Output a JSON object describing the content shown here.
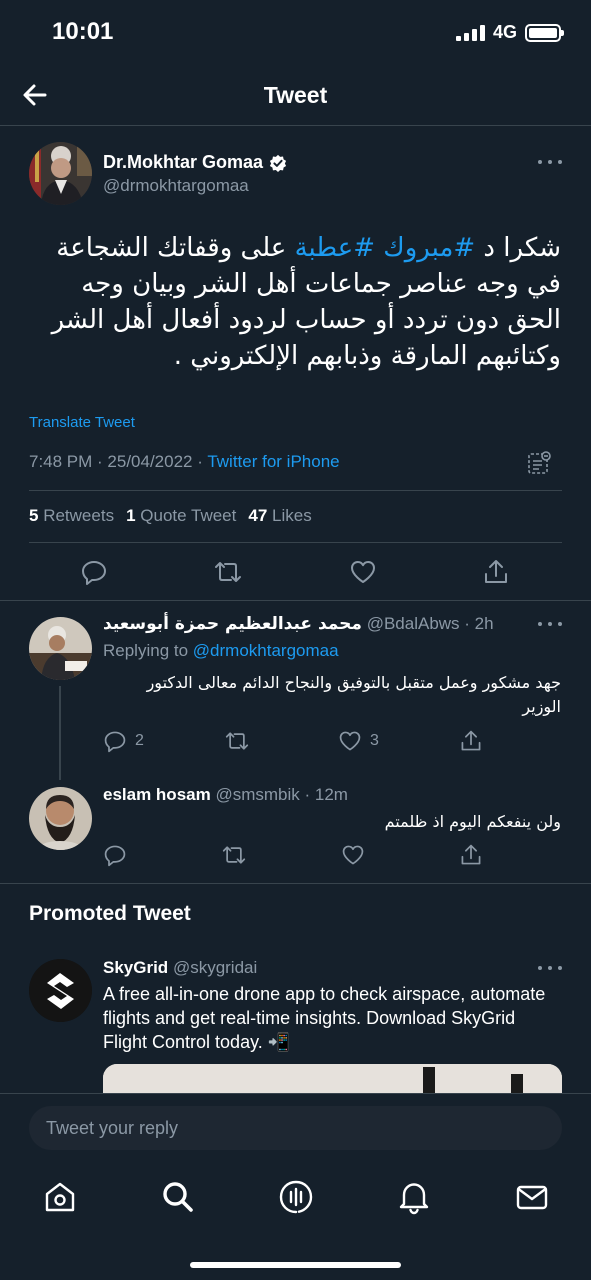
{
  "status_bar": {
    "time": "10:01",
    "network": "4G"
  },
  "header": {
    "title": "Tweet"
  },
  "tweet": {
    "author_name": "Dr.Mokhtar Gomaa",
    "author_handle": "@drmokhtargomaa",
    "verified": true,
    "text_before": "شكرا د ",
    "hashtag1": "#مبروك",
    "space": " ",
    "hashtag2": "#عطبة",
    "text_after": " على وقفاتك الشجاعة في وجه عناصر جماعات أهل الشر وبيان وجه الحق دون تردد أو حساب لردود أفعال أهل الشر وكتائبهم المارقة وذبابهم الإلكتروني .",
    "translate_label": "Translate Tweet",
    "time": "7:48 PM",
    "sep1": " · ",
    "date": "25/04/2022",
    "sep2": " · ",
    "source": "Twitter for iPhone",
    "retweets_count": "5",
    "retweets_label": "Retweets",
    "quotes_count": "1",
    "quotes_label": "Quote Tweet",
    "likes_count": "47",
    "likes_label": "Likes"
  },
  "replies": [
    {
      "name": "محمد عبدالعظيم حمزة أبوسعيد",
      "handle": "@BdalAbws",
      "age": " · 2h",
      "replying_prefix": "Replying to ",
      "replying_to": "@drmokhtargomaa",
      "text": "جهد مشكور وعمل متقبل بالتوفيق والنجاح الدائم معالى الدكتور الوزير",
      "reply_count": "2",
      "retweet_count": "",
      "like_count": "3"
    },
    {
      "name": "eslam hosam",
      "handle": "@smsmbik",
      "age": " · 12m",
      "text": "ولن ينفعكم اليوم اذ ظلمتم",
      "reply_count": "",
      "retweet_count": "",
      "like_count": ""
    }
  ],
  "promoted": {
    "section_title": "Promoted Tweet",
    "name": "SkyGrid",
    "handle": "@skygridai",
    "text": "A free all-in-one drone app to check airspace, automate flights and get real-time insights. Download SkyGrid Flight Control today. 📲"
  },
  "composer": {
    "placeholder": "Tweet your reply"
  },
  "tabs": [
    "home-icon",
    "search-icon",
    "spaces-icon",
    "notifications-icon",
    "messages-icon"
  ],
  "colors": {
    "background": "#15202b",
    "accent": "#1d9bf0",
    "secondary_text": "#8b98a5",
    "divider": "#38444d"
  }
}
